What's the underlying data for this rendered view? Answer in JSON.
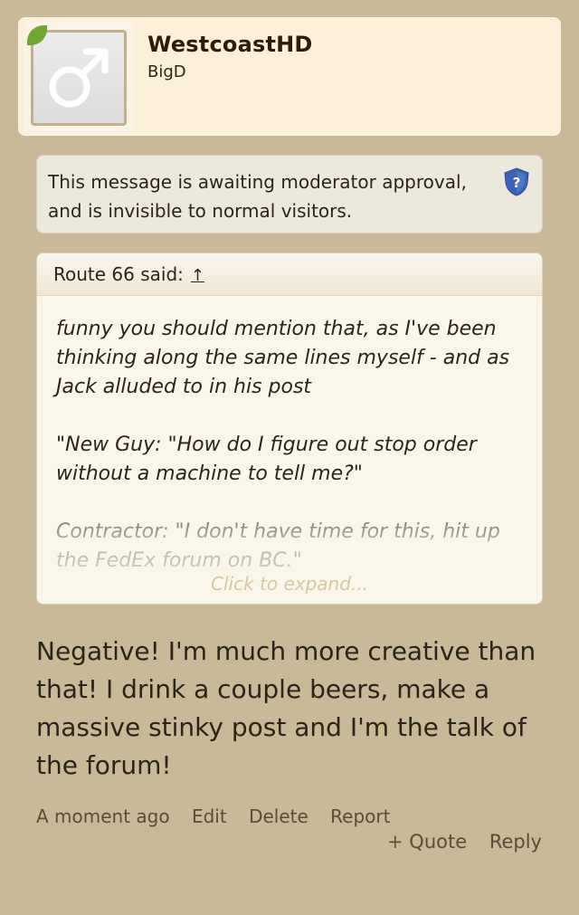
{
  "user": {
    "name": "WestcoastHD",
    "title": "BigD",
    "status_color": "#6fa533"
  },
  "moderation": {
    "notice": "This message is awaiting moderator approval, and is invisible to normal visitors.",
    "icon": "shield-question-icon"
  },
  "quote": {
    "attribution": "Route 66 said:",
    "jump_glyph": "↑",
    "paragraphs": [
      "funny you should mention that, as I've been thinking along the same lines myself - and as Jack alluded to in his post",
      "\"New Guy: \"How do I figure out stop order without a machine to tell me?\"",
      "Contractor: \"I don't have time for this, hit up the FedEx forum on BC.\""
    ],
    "expand_label": "Click to expand..."
  },
  "message": {
    "text": "Negative! I'm much more creative than that! I drink a couple beers, make a massive stinky post and I'm the talk of the forum!"
  },
  "footer": {
    "timestamp": "A moment ago",
    "edit_label": "Edit",
    "delete_label": "Delete",
    "report_label": "Report",
    "quote_label": "+ Quote",
    "reply_label": "Reply"
  }
}
